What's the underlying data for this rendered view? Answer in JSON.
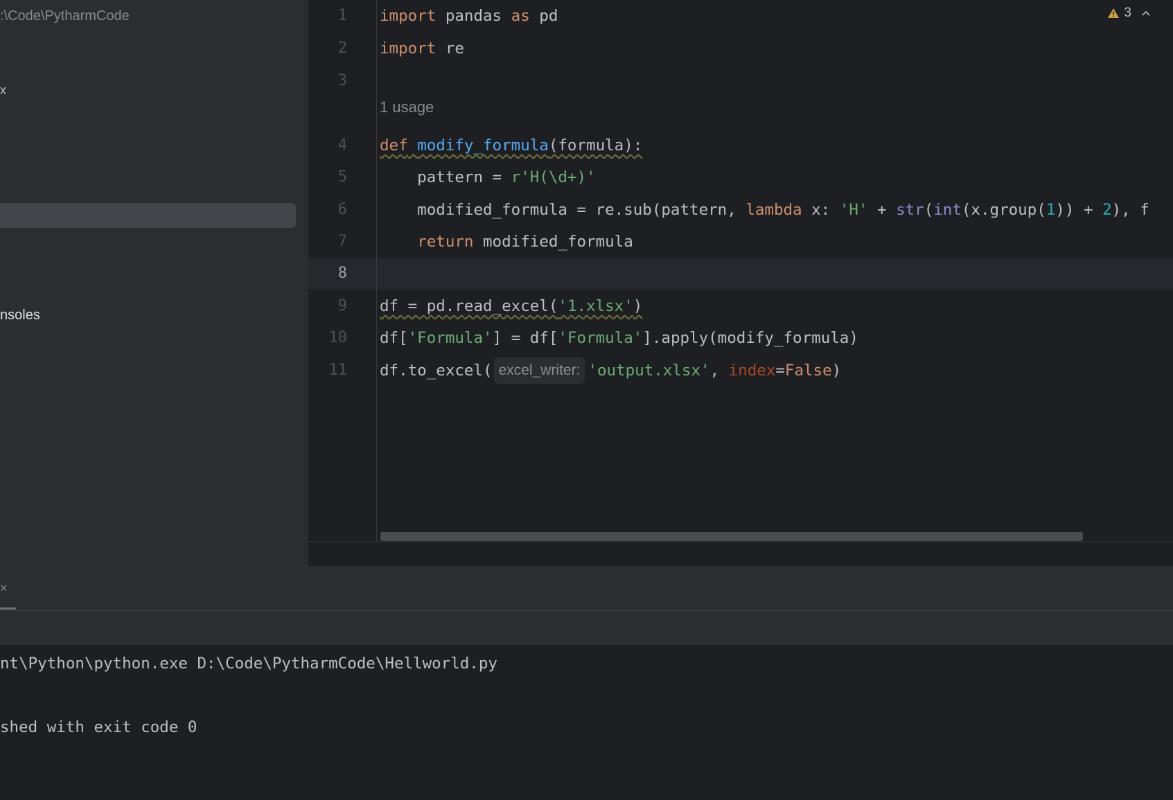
{
  "sidebar": {
    "path_text": ":\\Code\\PytharmCode",
    "truncated_item": "x",
    "consoles_label": "nsoles"
  },
  "editor": {
    "line_numbers": [
      "1",
      "2",
      "3",
      "4",
      "5",
      "6",
      "7",
      "8",
      "9",
      "10",
      "11"
    ],
    "usage_hint": "1 usage",
    "inlay_hint": "excel_writer:",
    "warning_count": "3",
    "tokens": {
      "import": "import",
      "pandas": " pandas ",
      "as": "as",
      "pd": " pd",
      "re_mod": " re",
      "def": "def",
      "func_name": "modify_formula",
      "func_params": "(formula):",
      "pattern_lhs": "    pattern = ",
      "pattern_val": "r'H(\\d+)'",
      "mf_lhs": "    modified_formula = re.sub(pattern, ",
      "lambda": "lambda",
      "x_colon": " x: ",
      "H_str": "'H'",
      "plus1": " + ",
      "str_fn": "str",
      "open1": "(",
      "int_fn": "int",
      "group_call": "(x.group(",
      "one": "1",
      "close_plus": ")) + ",
      "two": "2",
      "tail": "), f",
      "return": "return",
      "return_val": " modified_formula",
      "l9_code": "df = pd.read_excel(",
      "l9_str": "'1.xlsx'",
      "l9_end": ")",
      "l10_a": "df[",
      "l10_str1": "'Formula'",
      "l10_b": "] = df[",
      "l10_str2": "'Formula'",
      "l10_c": "].apply(modify_formula)",
      "l11_a": "df.to_excel(",
      "l11_str": "'output.xlsx'",
      "l11_comma": ", ",
      "l11_param": "index",
      "l11_eq": "=",
      "l11_false": "False",
      "l11_end": ")"
    }
  },
  "run": {
    "close_glyph": "×",
    "output_line1": "nt\\Python\\python.exe D:\\Code\\PytharmCode\\Hellworld.py",
    "output_line2": "shed with exit code 0"
  }
}
